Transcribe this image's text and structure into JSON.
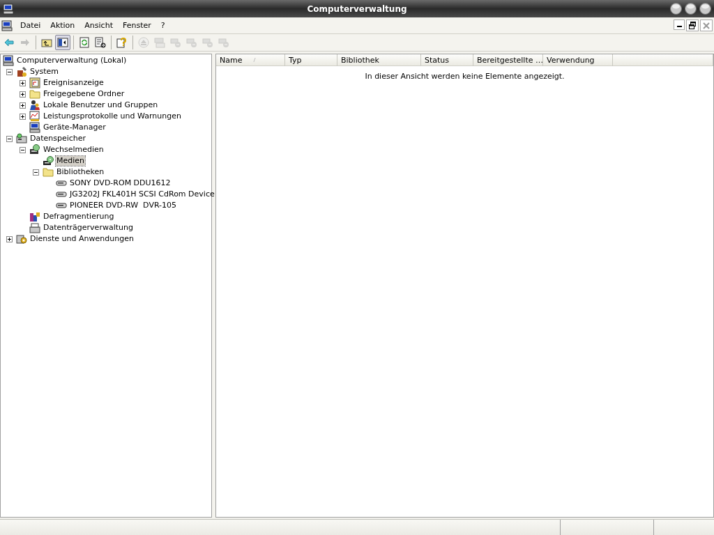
{
  "window": {
    "title": "Computerverwaltung"
  },
  "menu": [
    {
      "label": "Datei"
    },
    {
      "label": "Aktion"
    },
    {
      "label": "Ansicht"
    },
    {
      "label": "Fenster"
    },
    {
      "label": "?"
    }
  ],
  "toolbar": [
    {
      "kind": "back",
      "disabled": false,
      "pressed": false
    },
    {
      "kind": "forward",
      "disabled": true,
      "pressed": false
    },
    {
      "kind": "sep"
    },
    {
      "kind": "up",
      "disabled": false,
      "pressed": false
    },
    {
      "kind": "tree",
      "disabled": false,
      "pressed": true
    },
    {
      "kind": "sep"
    },
    {
      "kind": "refresh",
      "disabled": false,
      "pressed": false
    },
    {
      "kind": "export",
      "disabled": false,
      "pressed": false
    },
    {
      "kind": "sep"
    },
    {
      "kind": "help",
      "disabled": false,
      "pressed": false
    },
    {
      "kind": "sep"
    },
    {
      "kind": "eject",
      "disabled": true,
      "pressed": false
    },
    {
      "kind": "drive",
      "disabled": true,
      "pressed": false
    },
    {
      "kind": "net",
      "disabled": true,
      "pressed": false
    },
    {
      "kind": "net",
      "disabled": true,
      "pressed": false
    },
    {
      "kind": "net",
      "disabled": true,
      "pressed": false
    },
    {
      "kind": "net",
      "disabled": true,
      "pressed": false
    }
  ],
  "tree": {
    "label": "Computerverwaltung (Lokal)",
    "kind": "computer",
    "selected": false,
    "children": [
      {
        "label": "System",
        "kind": "tools",
        "expanded": true,
        "selected": false,
        "children": [
          {
            "label": "Ereignisanzeige",
            "kind": "log",
            "expanded": false,
            "selected": false
          },
          {
            "label": "Freigegebene Ordner",
            "kind": "folder",
            "expanded": false,
            "selected": false
          },
          {
            "label": "Lokale Benutzer und Gruppen",
            "kind": "users",
            "expanded": false,
            "selected": false
          },
          {
            "label": "Leistungsprotokolle und Warnungen",
            "kind": "chart",
            "expanded": false,
            "selected": false
          },
          {
            "label": "Geräte-Manager",
            "kind": "computer",
            "selected": false
          }
        ]
      },
      {
        "label": "Datenspeicher",
        "kind": "storage",
        "expanded": true,
        "selected": false,
        "children": [
          {
            "label": "Wechselmedien",
            "kind": "media",
            "expanded": true,
            "selected": false,
            "children": [
              {
                "label": "Medien",
                "kind": "disc",
                "selected": true
              },
              {
                "label": "Bibliotheken",
                "kind": "folder",
                "expanded": true,
                "selected": false,
                "children": [
                  {
                    "label": "SONY DVD-ROM DDU1612",
                    "kind": "drive",
                    "selected": false
                  },
                  {
                    "label": "JG3202J FKL401H SCSI CdRom Device",
                    "kind": "drive",
                    "selected": false
                  },
                  {
                    "label": "PIONEER DVD-RW  DVR-105",
                    "kind": "drive",
                    "selected": false
                  }
                ]
              }
            ]
          },
          {
            "label": "Defragmentierung",
            "kind": "defrag",
            "selected": false
          },
          {
            "label": "Datenträgerverwaltung",
            "kind": "disk",
            "selected": false
          }
        ]
      },
      {
        "label": "Dienste und Anwendungen",
        "kind": "services",
        "expanded": false,
        "selected": false
      }
    ]
  },
  "list": {
    "columns": [
      {
        "label": "Name",
        "sorted": true
      },
      {
        "label": "Typ",
        "sorted": false
      },
      {
        "label": "Bibliothek",
        "sorted": false
      },
      {
        "label": "Status",
        "sorted": false
      },
      {
        "label": "Bereitgestellte …",
        "sorted": false
      },
      {
        "label": "Verwendung",
        "sorted": false
      }
    ],
    "empty_message": "In dieser Ansicht werden keine Elemente angezeigt."
  }
}
